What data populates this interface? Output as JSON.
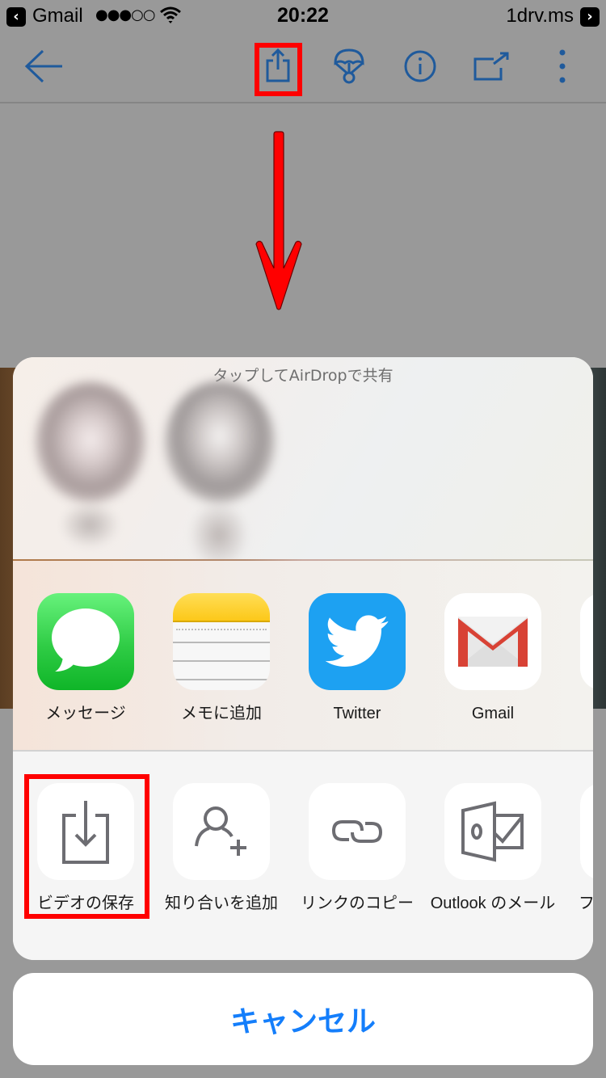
{
  "status_bar": {
    "back_app": "Gmail",
    "signal": "●●●○○",
    "time": "20:22",
    "site": "1drv.ms",
    "back_glyph": "‹",
    "fwd_glyph": "›"
  },
  "toolbar": {
    "icon_color": "#1f5a9c",
    "buttons": [
      {
        "name": "back",
        "icon": "arrow-left-icon"
      },
      {
        "name": "share",
        "icon": "share-icon",
        "highlighted": true
      },
      {
        "name": "offline",
        "icon": "parachute-icon"
      },
      {
        "name": "info",
        "icon": "info-icon"
      },
      {
        "name": "open-in",
        "icon": "open-external-icon"
      },
      {
        "name": "more",
        "icon": "more-vertical-icon"
      }
    ]
  },
  "annotation": {
    "color": "#ff0000",
    "arrow_direction": "down"
  },
  "share_sheet": {
    "airdrop_title": "タップしてAirDropで共有",
    "airdrop_contacts": [
      {
        "name": "blurred-contact-1"
      },
      {
        "name": "blurred-contact-2"
      }
    ],
    "apps": [
      {
        "label": "メッセージ",
        "icon": "messages-icon"
      },
      {
        "label": "メモに追加",
        "icon": "notes-icon"
      },
      {
        "label": "Twitter",
        "icon": "twitter-icon"
      },
      {
        "label": "Gmail",
        "icon": "gmail-icon"
      }
    ],
    "actions": [
      {
        "label": "ビデオの保存",
        "icon": "save-download-icon",
        "highlighted": true
      },
      {
        "label": "知り合いを追加",
        "icon": "add-contact-icon"
      },
      {
        "label": "リンクのコピー",
        "icon": "link-icon"
      },
      {
        "label": "Outlook のメール",
        "icon": "outlook-icon"
      },
      {
        "label": "フ",
        "icon": "partial-icon"
      }
    ]
  },
  "cancel": {
    "label": "キャンセル",
    "color": "#147efb"
  }
}
